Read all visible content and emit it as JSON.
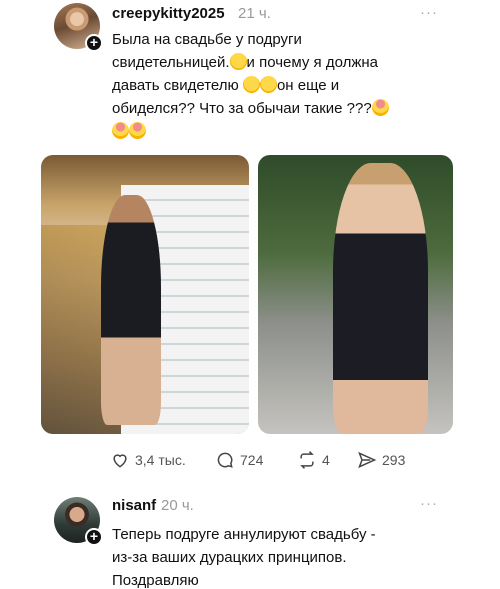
{
  "post": {
    "username": "creepykitty2025",
    "time": "21 ч.",
    "more": "···",
    "text_line1": "Была на свадьбе у подруги",
    "text_line2a": "свидетельницей.",
    "text_line2b": "и почему я должна",
    "text_line3a": "давать свидетелю",
    "text_line3b": "он еще и",
    "text_line4": "обиделся?? Что за обычаи такие ???",
    "likes": "3,4 тыс.",
    "comments": "724",
    "reposts": "4",
    "shares": "293"
  },
  "reply": {
    "username": "nisanf",
    "time": "20 ч.",
    "more": "···",
    "text_line1": "Теперь подруге аннулируют свадьбу -",
    "text_line2": "из-за ваших дурацких принципов.",
    "text_line3": "Поздравляю"
  },
  "icons": {
    "like": "heart-icon",
    "comment": "comment-icon",
    "repost": "repost-icon",
    "share": "send-icon"
  }
}
